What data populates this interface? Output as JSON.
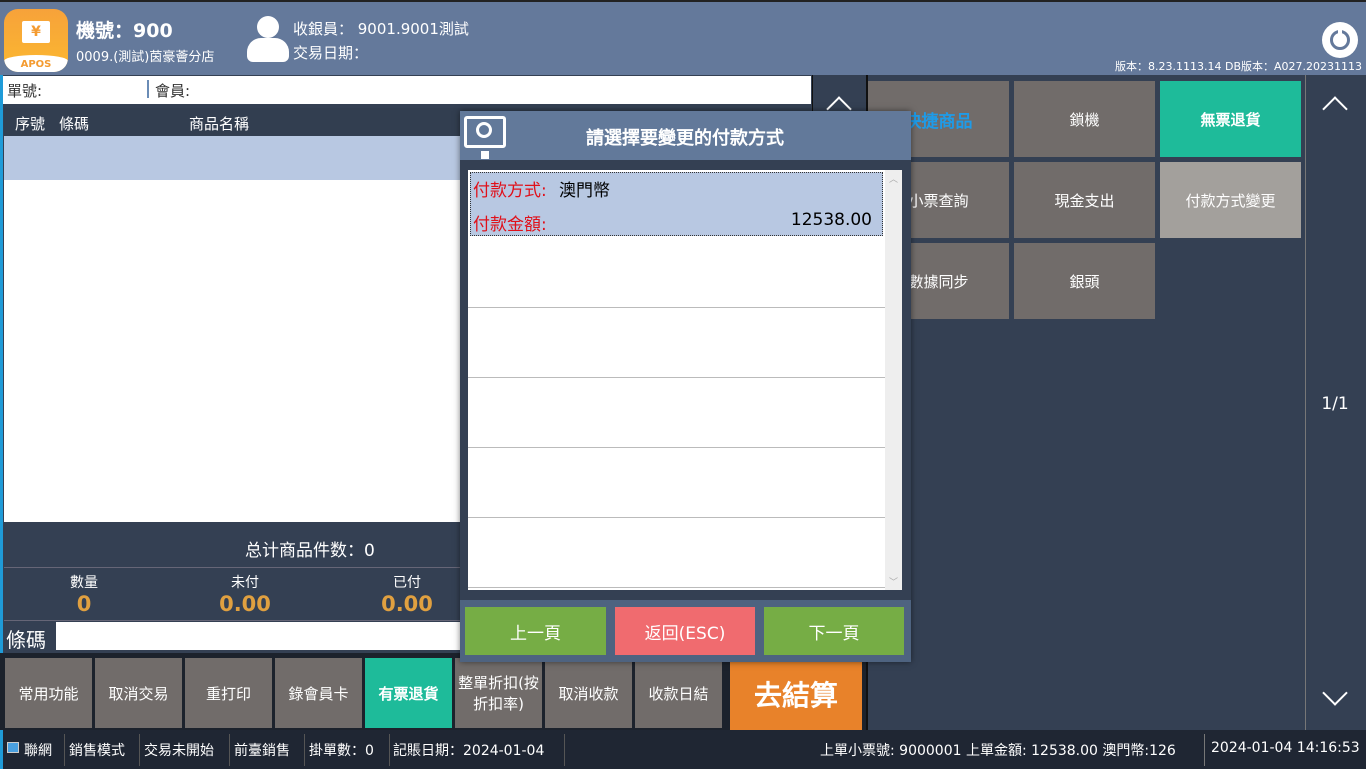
{
  "header": {
    "machine": "機號：900",
    "store": "0009.(測試)茵豪薈分店",
    "cashier": "收銀員：  9001.9001測試",
    "trade_date": "交易日期：",
    "version": "版本：8.23.1113.14 DB版本：A027.20231113",
    "logo_text": "APOS",
    "logo_symbol": "¥"
  },
  "info": {
    "order_no": "單號:",
    "member": "會員:"
  },
  "table": {
    "headers": [
      "序號",
      "條碼",
      "商品名稱"
    ]
  },
  "summary": {
    "total_items": "总计商品件数：0",
    "qty_label": "數量",
    "qty": "0",
    "unpaid_label": "未付",
    "unpaid": "0.00",
    "paid_label": "已付",
    "paid": "0.00"
  },
  "barcode": {
    "label": "條碼",
    "value": ""
  },
  "bottom_buttons": [
    "常用功能",
    "取消交易",
    "重打印",
    "錄會員卡",
    "有票退貨",
    "整單折扣(按折扣率)",
    "取消收款",
    "收款日結"
  ],
  "checkout": "去結算",
  "grid": [
    "快捷商品",
    "鎖機",
    "無票退貨",
    "小票查詢",
    "現金支出",
    "付款方式變更",
    "數據同步",
    "銀頭"
  ],
  "page_indicator": "1/1",
  "dialog": {
    "title": "請選擇要變更的付款方式",
    "items": [
      {
        "method_label": "付款方式:",
        "method": "澳門幣",
        "amount_label": "付款金額:",
        "amount": "12538.00"
      }
    ],
    "prev": "上一頁",
    "back": "返回(ESC)",
    "next": "下一頁"
  },
  "status": {
    "network": "聯網",
    "mode": "銷售模式",
    "trade": "交易未開始",
    "front": "前臺銷售",
    "held": "掛單數：0",
    "acct_date": "記賬日期：2024-01-04",
    "last": "上單小票號: 9000001 上單金額: 12538.00  澳門幣:126",
    "datetime": "2024-01-04 14:16:53"
  },
  "colors": {
    "header": "#64799b",
    "teal": "#1ebb9a",
    "orange": "#e8822a",
    "green": "#76ad45",
    "red": "#f06b6f",
    "amount": "#e0a040"
  }
}
